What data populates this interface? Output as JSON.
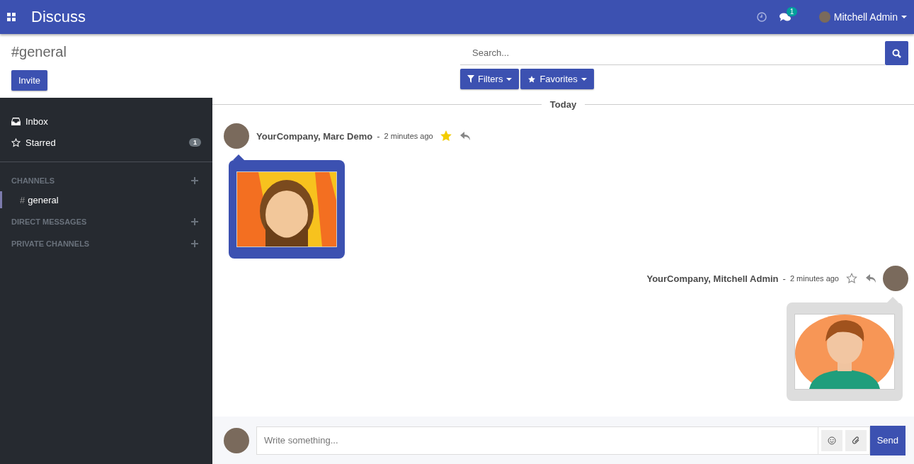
{
  "navbar": {
    "app_title": "Discuss",
    "chat_badge": "1",
    "user_name": "Mitchell Admin"
  },
  "control_panel": {
    "title": "#general",
    "invite_button": "Invite",
    "search": {
      "placeholder": "Search..."
    },
    "filters_button": "Filters",
    "favorites_button": "Favorites"
  },
  "sidebar": {
    "items": [
      {
        "label": "Inbox",
        "selected": false
      },
      {
        "label": "Starred",
        "selected": false,
        "counter": "1"
      }
    ],
    "sections": [
      {
        "title": "CHANNELS",
        "channels": [
          {
            "prefix": "#",
            "label": "general",
            "selected": true
          }
        ]
      },
      {
        "title": "DIRECT MESSAGES"
      },
      {
        "title": "PRIVATE CHANNELS"
      }
    ]
  },
  "thread": {
    "date_separator": "Today",
    "messages": [
      {
        "kind": "received",
        "author": "YourCompany, Marc Demo",
        "separator": "-",
        "time": "2 minutes ago",
        "starred": true
      },
      {
        "kind": "sent",
        "author": "YourCompany, Mitchell Admin",
        "separator": "-",
        "time": "2 minutes ago",
        "starred": false
      }
    ]
  },
  "composer": {
    "placeholder": "Write something...",
    "send_button": "Send"
  }
}
